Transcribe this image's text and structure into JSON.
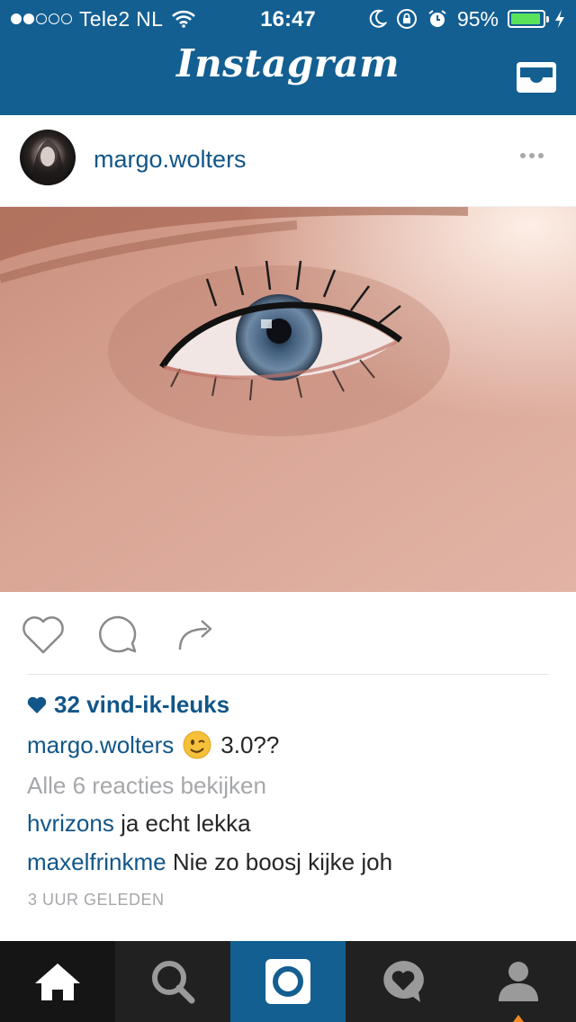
{
  "status_bar": {
    "carrier": "Tele2 NL",
    "time": "16:47",
    "battery_percent": "95%",
    "battery_level": 0.95,
    "signal_bars_filled": 2,
    "signal_bars_total": 5
  },
  "nav": {
    "title": "Instagram",
    "inbox_icon": "inbox-icon"
  },
  "post": {
    "username": "margo.wolters",
    "likes": "32 vind-ik-leuks",
    "caption_user": "margo.wolters",
    "caption_text": "3.0??",
    "view_all_comments": "Alle 6 reacties bekijken",
    "comments": [
      {
        "user": "hvrizons",
        "text": "ja echt lekka"
      },
      {
        "user": "maxelfrinkme",
        "text": "Nie zo boosj kijke joh"
      }
    ],
    "timestamp": "3 UUR GELEDEN"
  },
  "tabs": [
    {
      "name": "home",
      "icon": "home-icon",
      "active": true
    },
    {
      "name": "search",
      "icon": "search-icon"
    },
    {
      "name": "camera",
      "icon": "camera-icon"
    },
    {
      "name": "activity",
      "icon": "heart-bubble-icon"
    },
    {
      "name": "profile",
      "icon": "profile-icon"
    }
  ],
  "colors": {
    "brand_blue": "#135f92",
    "link_blue": "#125688",
    "muted_gray": "#a5a7aa",
    "tabbar_bg": "#212121"
  }
}
